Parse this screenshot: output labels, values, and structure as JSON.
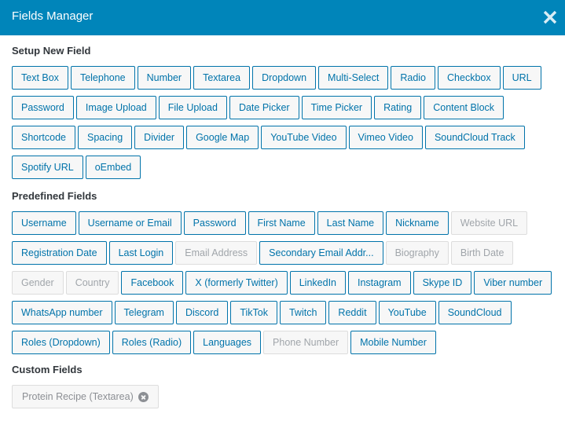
{
  "modal": {
    "title": "Fields Manager",
    "close_icon": "close-x-icon",
    "header_color": "#0085ba"
  },
  "sections": {
    "setup": {
      "title": "Setup New Field",
      "fields": [
        {
          "label": "Text Box",
          "disabled": false
        },
        {
          "label": "Telephone",
          "disabled": false
        },
        {
          "label": "Number",
          "disabled": false
        },
        {
          "label": "Textarea",
          "disabled": false
        },
        {
          "label": "Dropdown",
          "disabled": false
        },
        {
          "label": "Multi-Select",
          "disabled": false
        },
        {
          "label": "Radio",
          "disabled": false
        },
        {
          "label": "Checkbox",
          "disabled": false
        },
        {
          "label": "URL",
          "disabled": false
        },
        {
          "label": "Password",
          "disabled": false
        },
        {
          "label": "Image Upload",
          "disabled": false
        },
        {
          "label": "File Upload",
          "disabled": false
        },
        {
          "label": "Date Picker",
          "disabled": false
        },
        {
          "label": "Time Picker",
          "disabled": false
        },
        {
          "label": "Rating",
          "disabled": false
        },
        {
          "label": "Content Block",
          "disabled": false
        },
        {
          "label": "Shortcode",
          "disabled": false
        },
        {
          "label": "Spacing",
          "disabled": false
        },
        {
          "label": "Divider",
          "disabled": false
        },
        {
          "label": "Google Map",
          "disabled": false
        },
        {
          "label": "YouTube Video",
          "disabled": false
        },
        {
          "label": "Vimeo Video",
          "disabled": false
        },
        {
          "label": "SoundCloud Track",
          "disabled": false
        },
        {
          "label": "Spotify URL",
          "disabled": false
        },
        {
          "label": "oEmbed",
          "disabled": false
        }
      ]
    },
    "predefined": {
      "title": "Predefined Fields",
      "fields": [
        {
          "label": "Username",
          "disabled": false
        },
        {
          "label": "Username or Email",
          "disabled": false
        },
        {
          "label": "Password",
          "disabled": false
        },
        {
          "label": "First Name",
          "disabled": false
        },
        {
          "label": "Last Name",
          "disabled": false
        },
        {
          "label": "Nickname",
          "disabled": false
        },
        {
          "label": "Website URL",
          "disabled": true
        },
        {
          "label": "Registration Date",
          "disabled": false
        },
        {
          "label": "Last Login",
          "disabled": false
        },
        {
          "label": "Email Address",
          "disabled": true
        },
        {
          "label": "Secondary Email Addr...",
          "disabled": false
        },
        {
          "label": "Biography",
          "disabled": true
        },
        {
          "label": "Birth Date",
          "disabled": true
        },
        {
          "label": "Gender",
          "disabled": true
        },
        {
          "label": "Country",
          "disabled": true
        },
        {
          "label": "Facebook",
          "disabled": false
        },
        {
          "label": "X (formerly Twitter)",
          "disabled": false
        },
        {
          "label": "LinkedIn",
          "disabled": false
        },
        {
          "label": "Instagram",
          "disabled": false
        },
        {
          "label": "Skype ID",
          "disabled": false
        },
        {
          "label": "Viber number",
          "disabled": false
        },
        {
          "label": "WhatsApp number",
          "disabled": false
        },
        {
          "label": "Telegram",
          "disabled": false
        },
        {
          "label": "Discord",
          "disabled": false
        },
        {
          "label": "TikTok",
          "disabled": false
        },
        {
          "label": "Twitch",
          "disabled": false
        },
        {
          "label": "Reddit",
          "disabled": false
        },
        {
          "label": "YouTube",
          "disabled": false
        },
        {
          "label": "SoundCloud",
          "disabled": false
        },
        {
          "label": "Roles (Dropdown)",
          "disabled": false
        },
        {
          "label": "Roles (Radio)",
          "disabled": false
        },
        {
          "label": "Languages",
          "disabled": false
        },
        {
          "label": "Phone Number",
          "disabled": true
        },
        {
          "label": "Mobile Number",
          "disabled": false
        }
      ]
    },
    "custom": {
      "title": "Custom Fields",
      "fields": [
        {
          "label": "Protein Recipe (Textarea)",
          "remove_icon": "remove-circle-icon"
        }
      ]
    }
  },
  "colors": {
    "accent": "#0073aa",
    "disabled_text": "#a0a5aa",
    "disabled_border": "#dddddd",
    "button_bg": "#f7f7f7"
  }
}
